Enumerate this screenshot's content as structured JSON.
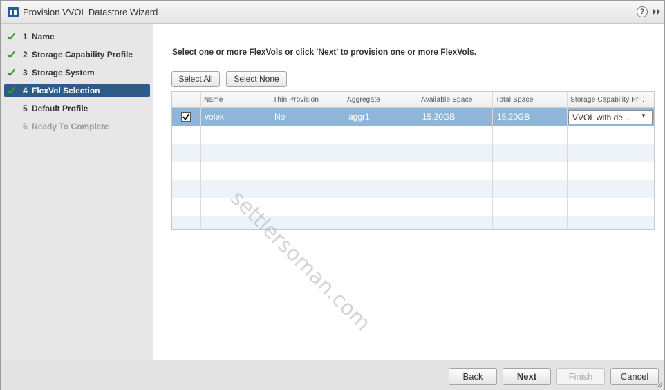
{
  "window": {
    "title": "Provision VVOL Datastore Wizard",
    "icons": [
      "app-logo-icon",
      "help-icon",
      "expand-icon"
    ],
    "help_glyph": "?"
  },
  "sidebar": {
    "steps": [
      {
        "num": "1",
        "label": "Name",
        "state": "completed"
      },
      {
        "num": "2",
        "label": "Storage Capability Profile",
        "state": "completed"
      },
      {
        "num": "3",
        "label": "Storage System",
        "state": "completed"
      },
      {
        "num": "4",
        "label": "FlexVol Selection",
        "state": "active"
      },
      {
        "num": "5",
        "label": "Default Profile",
        "state": "pending"
      },
      {
        "num": "6",
        "label": "Ready To Complete",
        "state": "disabled"
      }
    ]
  },
  "main": {
    "instruction": "Select one or more FlexVols or click 'Next' to provision one or more FlexVols.",
    "select_all_label": "Select All",
    "select_none_label": "Select None",
    "grid": {
      "columns": [
        "Name",
        "Thin Provision",
        "Aggregate",
        "Available Space",
        "Total Space",
        "Storage Capability Pr..."
      ],
      "rows": [
        {
          "checked": true,
          "name": "volek",
          "thin_provision": "No",
          "aggregate": "aggr1",
          "available_space": "15,20GB",
          "total_space": "15,20GB",
          "profile": "VVOL with de..."
        }
      ]
    },
    "watermark": "settlersoman.com"
  },
  "footer": {
    "back_label": "Back",
    "next_label": "Next",
    "finish_label": "Finish",
    "cancel_label": "Cancel"
  },
  "colors": {
    "active_step": "#2f5b89",
    "selected_row": "#8fb5d9",
    "check_green": "#3a9a2e",
    "alt_row": "#eef3fa"
  }
}
